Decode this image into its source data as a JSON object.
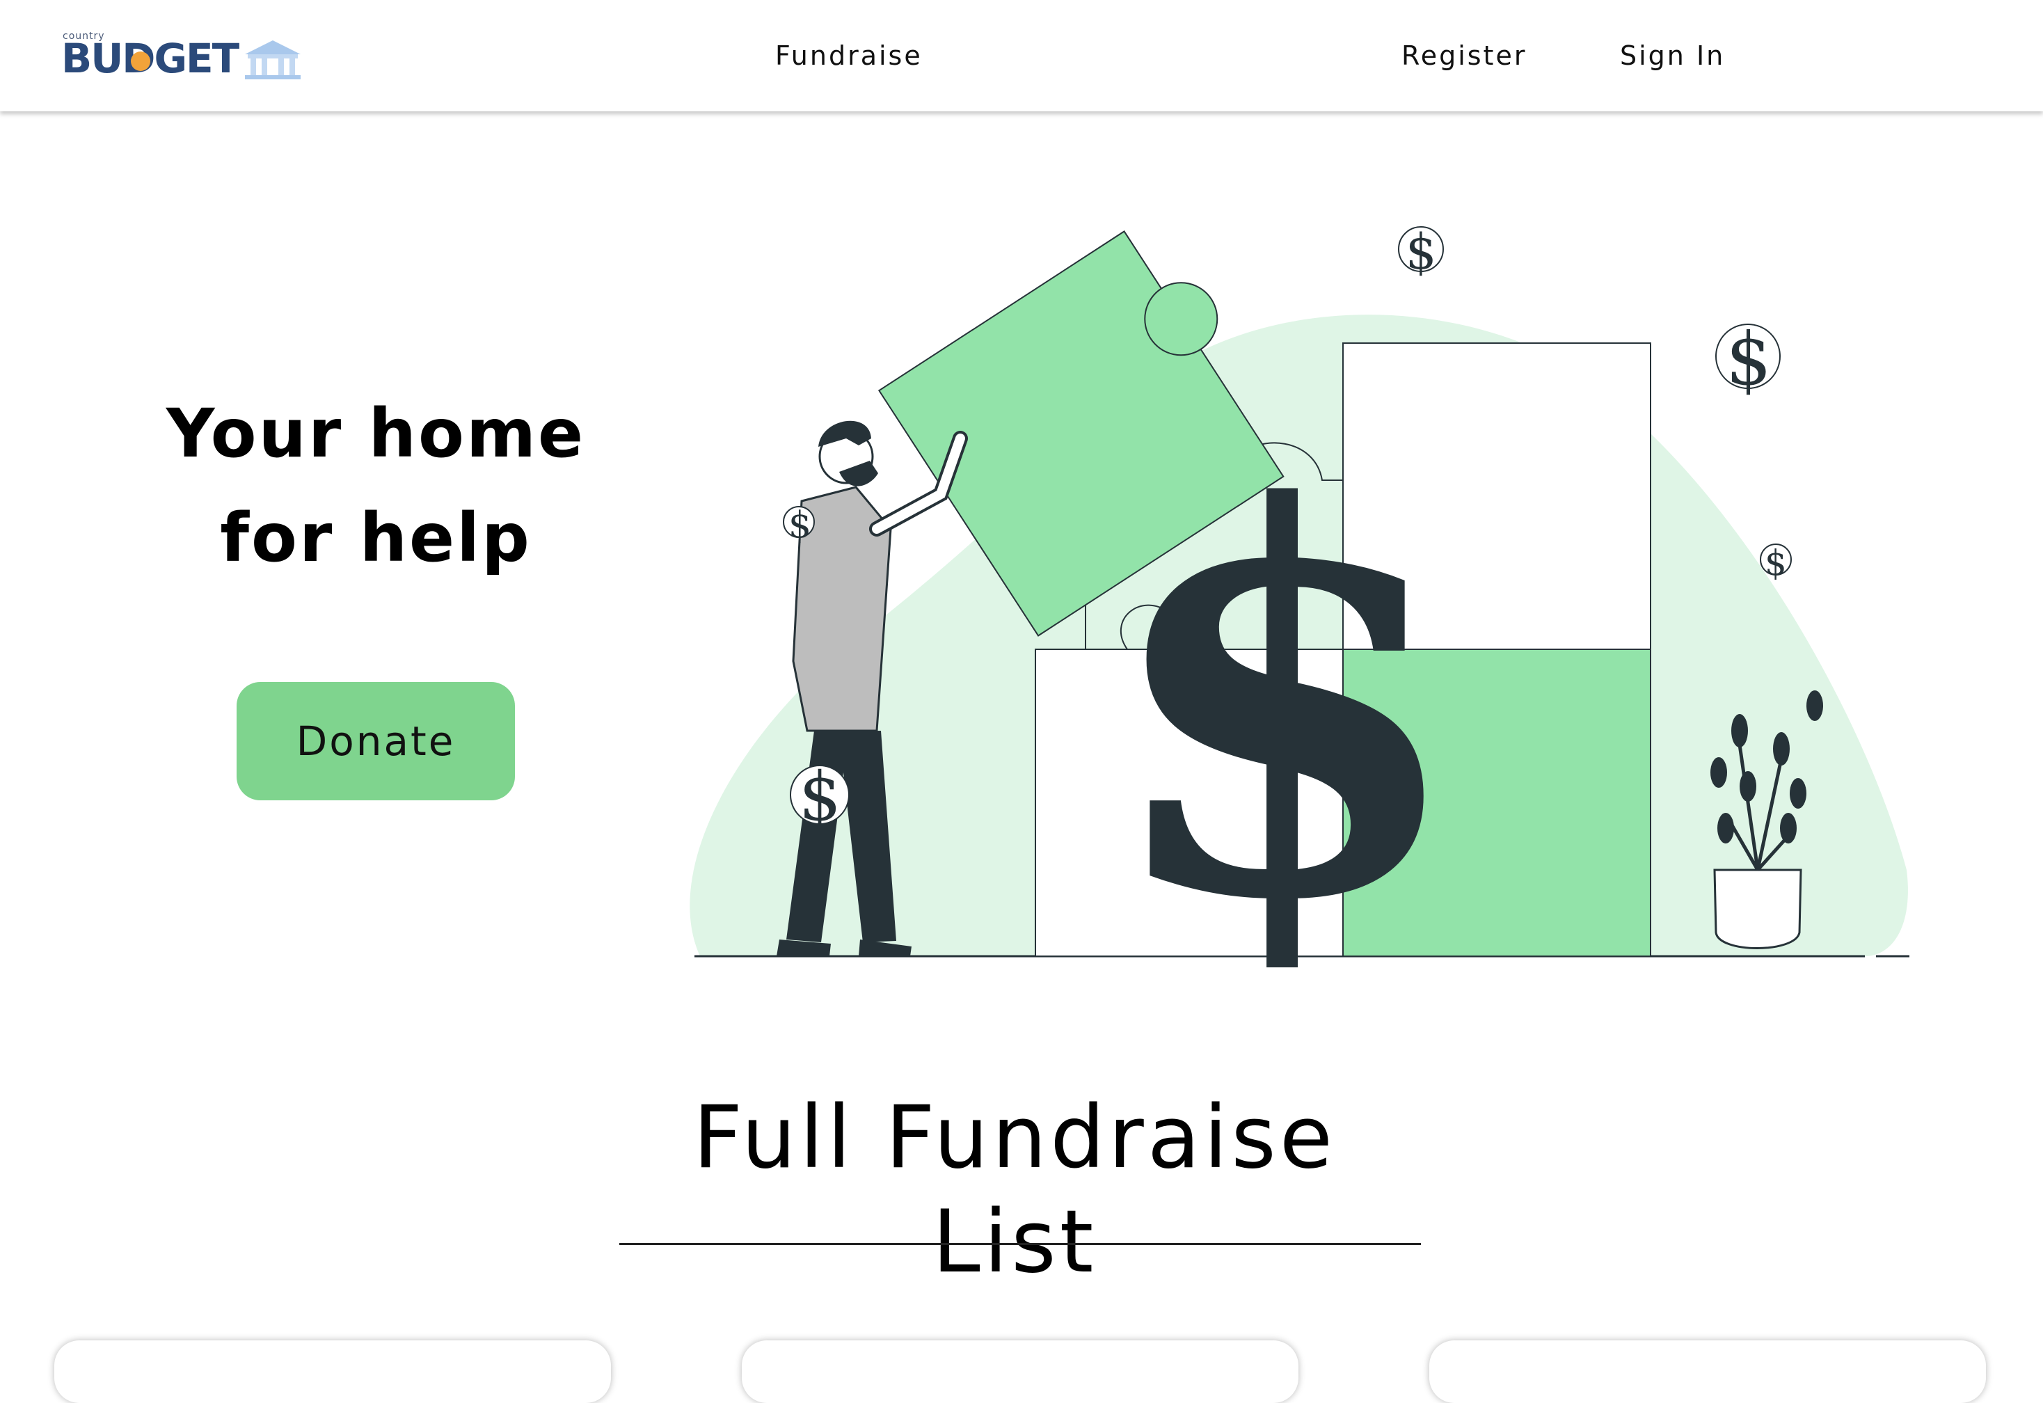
{
  "brand": {
    "logo_small": "country",
    "logo_word": "BUDGET",
    "accent_color": "#7fd48e",
    "illustration_green": "#92e3a9",
    "illustration_light": "#dff5e6",
    "illustration_dark": "#263238"
  },
  "nav": {
    "fundraise": "Fundraise",
    "register": "Register",
    "sign_in": "Sign In"
  },
  "hero": {
    "title_line1": "Your home",
    "title_line2": "for help",
    "donate_label": "Donate",
    "illustration_icons": [
      "dollar-puzzle",
      "man-figure",
      "plant-pot",
      "dollar-coin"
    ]
  },
  "fundraise_list": {
    "title": "Full Fundraise List",
    "card_count_visible": 3
  }
}
